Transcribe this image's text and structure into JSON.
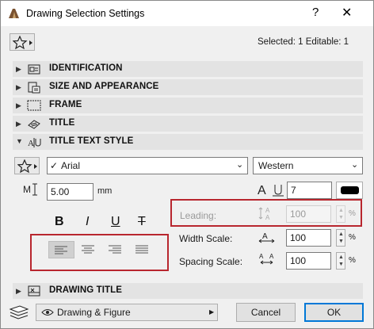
{
  "window": {
    "title": "Drawing Selection Settings",
    "help": "?",
    "close": "✕"
  },
  "header": {
    "status": "Selected: 1 Editable: 1"
  },
  "sections": [
    {
      "label": "IDENTIFICATION"
    },
    {
      "label": "SIZE AND APPEARANCE"
    },
    {
      "label": "FRAME"
    },
    {
      "label": "TITLE"
    },
    {
      "label": "TITLE TEXT STYLE"
    },
    {
      "label": "DRAWING TITLE"
    }
  ],
  "text_style": {
    "font": "Arial",
    "script": "Western",
    "size_value": "5.00",
    "size_unit": "mm",
    "pen_value": "7",
    "bold": "B",
    "italic": "I",
    "underline": "U",
    "strike": "T",
    "leading_label": "Leading:",
    "leading_value": "100",
    "leading_unit": "%",
    "width_label": "Width Scale:",
    "width_value": "100",
    "width_unit": "%",
    "spacing_label": "Spacing Scale:",
    "spacing_value": "100",
    "spacing_unit": "%"
  },
  "footer": {
    "layer": "Drawing & Figure",
    "cancel": "Cancel",
    "ok": "OK"
  },
  "colors": {
    "highlight": "#b8262e",
    "ok_border": "#0078d7"
  }
}
